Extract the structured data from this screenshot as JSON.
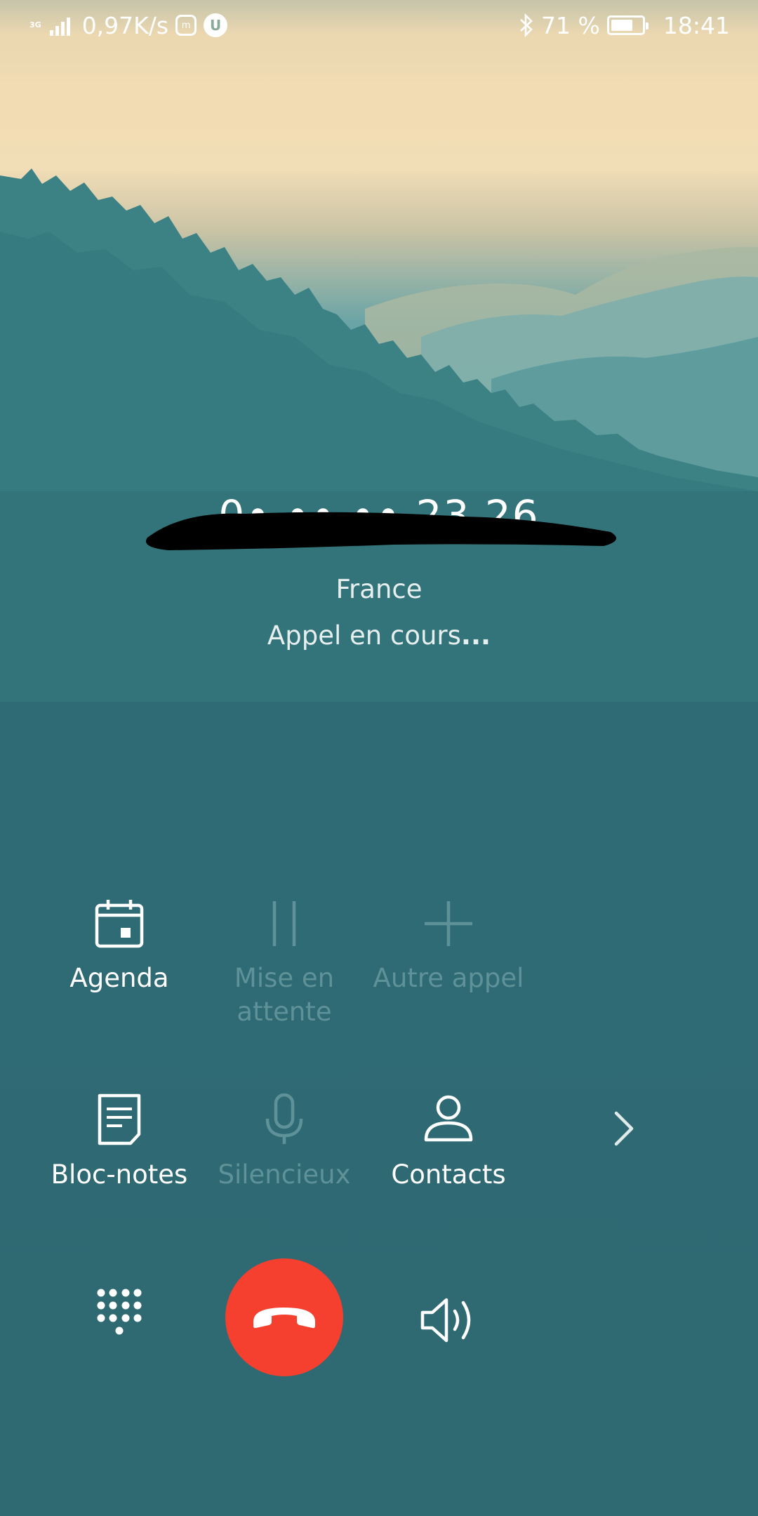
{
  "status_bar": {
    "network": "3G",
    "speed": "0,97K/s",
    "battery_percent": "71 %",
    "battery_level": 0.71,
    "time": "18:41",
    "icons": [
      "signal-icon",
      "app-notification-icon",
      "app-notification-icon",
      "bluetooth-icon",
      "battery-icon"
    ]
  },
  "call": {
    "number": "0• •• •• 23 26",
    "country": "France",
    "status": "Appel en cours",
    "status_dots": "..."
  },
  "actions": [
    {
      "label": "Agenda",
      "icon": "calendar-icon",
      "enabled": true
    },
    {
      "label": "Mise en attente",
      "icon": "pause-icon",
      "enabled": false
    },
    {
      "label": "Autre appel",
      "icon": "add-call-icon",
      "enabled": false
    },
    {
      "label": "Bloc-notes",
      "icon": "notepad-icon",
      "enabled": true
    },
    {
      "label": "Silencieux",
      "icon": "microphone-icon",
      "enabled": false
    },
    {
      "label": "Contacts",
      "icon": "contact-icon",
      "enabled": true
    }
  ],
  "bottom": {
    "dialpad_icon": "dialpad-icon",
    "end_call_icon": "end-call-icon",
    "speaker_icon": "speaker-icon",
    "more_icon": "chevron-right-icon"
  },
  "colors": {
    "end_call": "#f5402f",
    "background": "#2f6a73",
    "disabled": "#5f9298"
  }
}
